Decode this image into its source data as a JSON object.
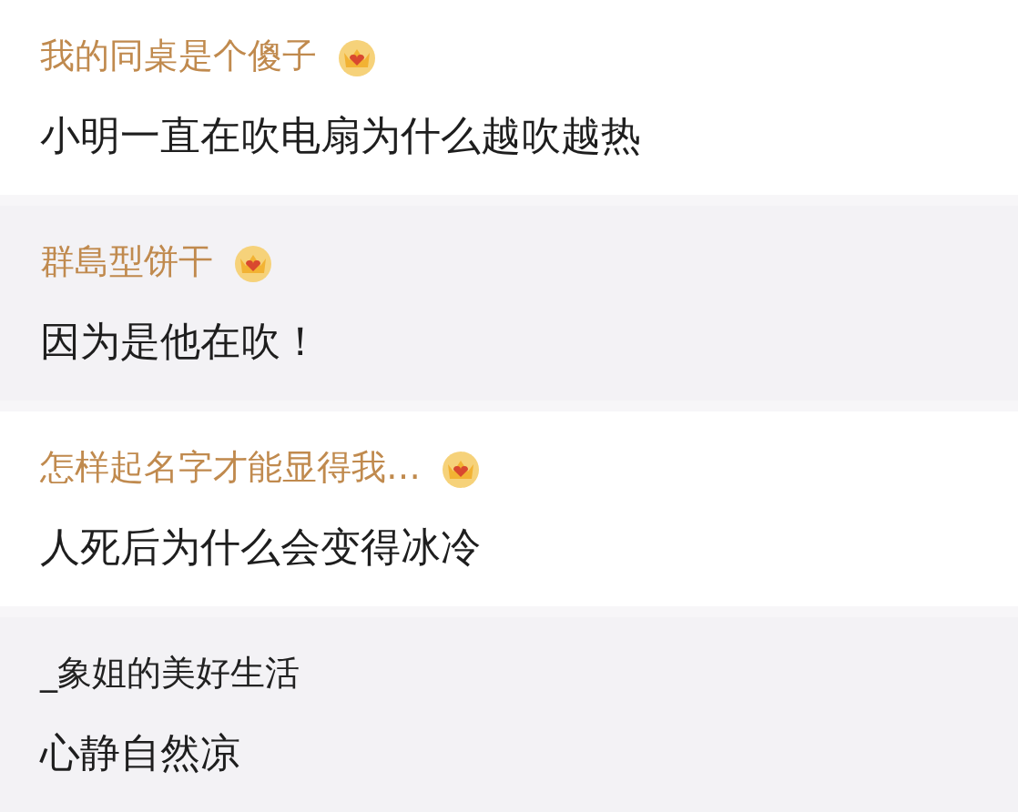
{
  "comments": [
    {
      "username": "我的同桌是个傻子",
      "vip": true,
      "text": "小明一直在吹电扇为什么越吹越热"
    },
    {
      "username": "群島型饼干",
      "vip": true,
      "text": "因为是他在吹！"
    },
    {
      "username": "怎样起名字才能显得我…",
      "vip": true,
      "text": "人死后为什么会变得冰冷"
    },
    {
      "username": "_象姐的美好生活",
      "vip": false,
      "text": "心静自然凉"
    }
  ]
}
